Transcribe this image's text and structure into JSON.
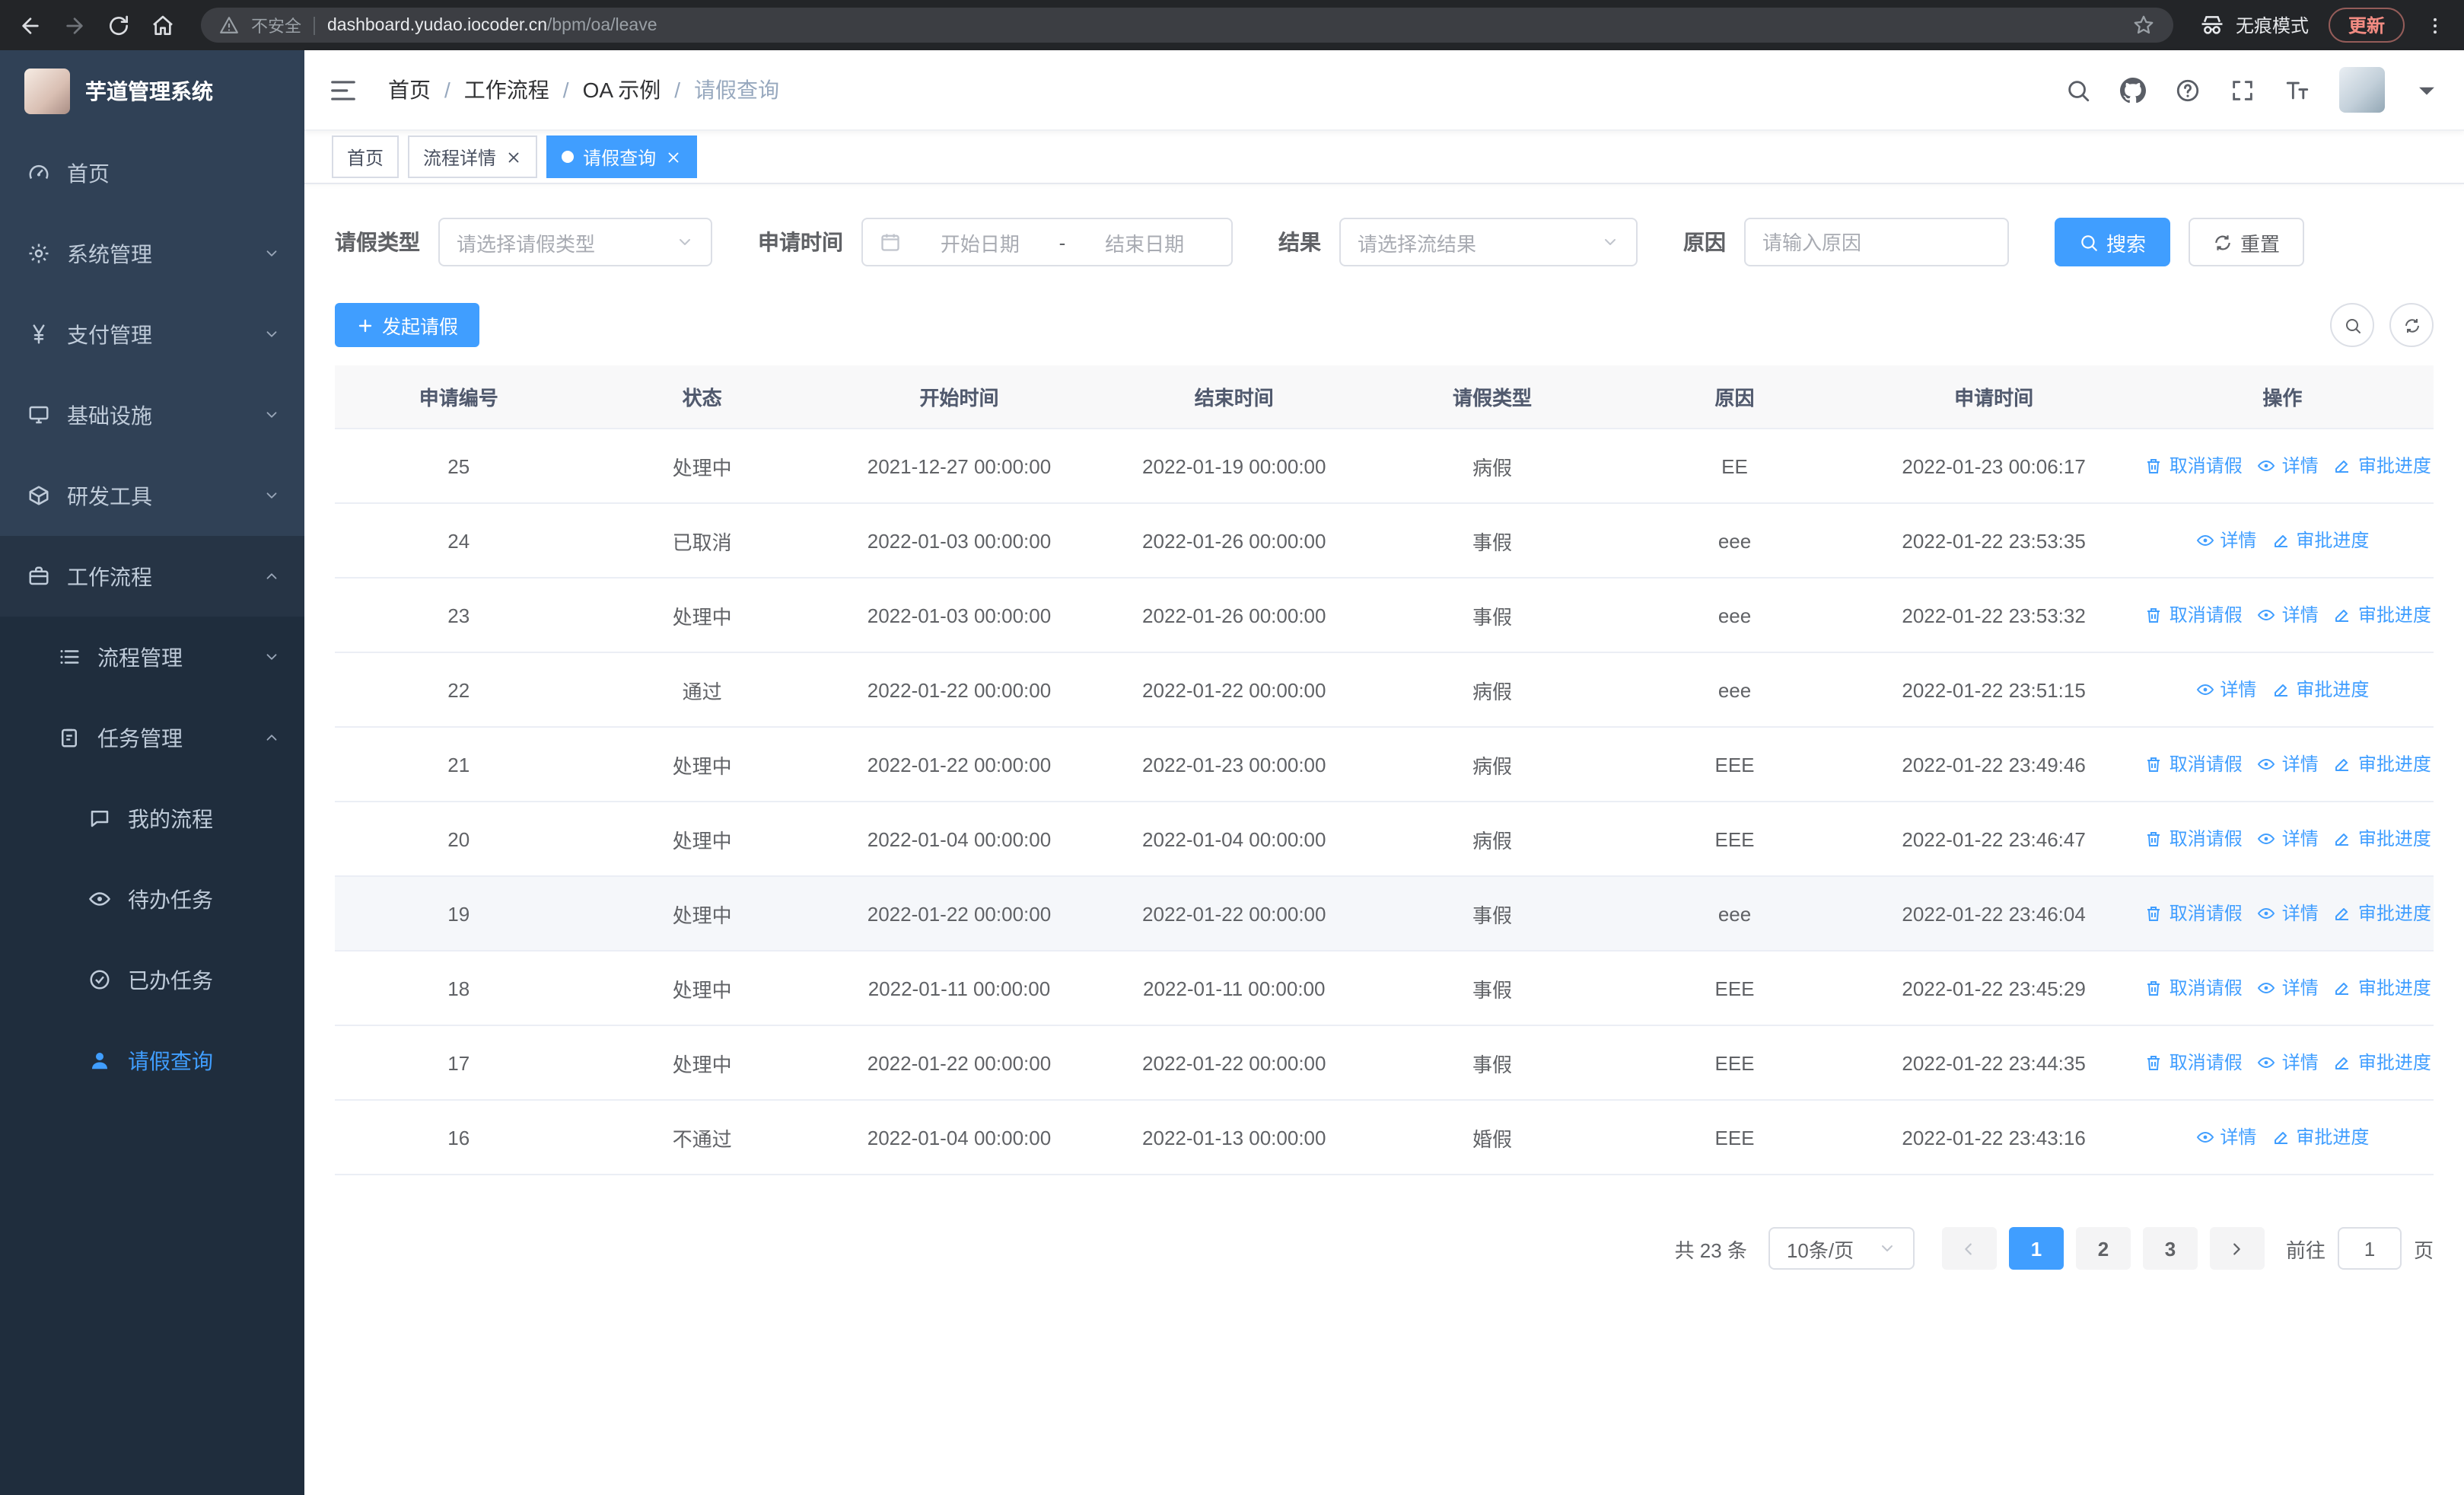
{
  "browser": {
    "security": "不安全",
    "url_domain": "dashboard.yudao.iocoder.cn",
    "url_path": "/bpm/oa/leave",
    "incognito": "无痕模式",
    "update": "更新"
  },
  "sidebar": {
    "title": "芋道管理系统",
    "menu": [
      {
        "key": "home",
        "label": "首页",
        "icon": "dashboard-icon",
        "level": 1,
        "arrow": null
      },
      {
        "key": "system",
        "label": "系统管理",
        "icon": "gear-icon",
        "level": 1,
        "arrow": "down"
      },
      {
        "key": "payment",
        "label": "支付管理",
        "icon": "yen-icon",
        "level": 1,
        "arrow": "down"
      },
      {
        "key": "infra",
        "label": "基础设施",
        "icon": "monitor-icon",
        "level": 1,
        "arrow": "down"
      },
      {
        "key": "dev-tools",
        "label": "研发工具",
        "icon": "box-icon",
        "level": 1,
        "arrow": "down"
      },
      {
        "key": "workflow",
        "label": "工作流程",
        "icon": "briefcase-icon",
        "level": 1,
        "arrow": "up",
        "open": true
      },
      {
        "key": "process-mgmt",
        "label": "流程管理",
        "icon": "list-icon",
        "level": 2,
        "arrow": "down"
      },
      {
        "key": "task-mgmt",
        "label": "任务管理",
        "icon": "clipboard-icon",
        "level": 2,
        "arrow": "up",
        "open": true
      },
      {
        "key": "my-process",
        "label": "我的流程",
        "icon": "chat-icon",
        "level": 3,
        "arrow": null
      },
      {
        "key": "todo-tasks",
        "label": "待办任务",
        "icon": "eye-icon",
        "level": 3,
        "arrow": null
      },
      {
        "key": "done-tasks",
        "label": "已办任务",
        "icon": "check-circle-icon",
        "level": 3,
        "arrow": null
      },
      {
        "key": "leave-query",
        "label": "请假查询",
        "icon": "user-icon",
        "level": 3,
        "arrow": null,
        "active": true
      }
    ]
  },
  "header": {
    "breadcrumb": [
      "首页",
      "工作流程",
      "OA 示例",
      "请假查询"
    ],
    "breadcrumb_separator": "/"
  },
  "tabs": [
    {
      "key": "home",
      "label": "首页",
      "active": false,
      "closable": false
    },
    {
      "key": "process-detail",
      "label": "流程详情",
      "active": false,
      "closable": true
    },
    {
      "key": "leave-query",
      "label": "请假查询",
      "active": true,
      "closable": true
    }
  ],
  "filters": {
    "leave_type_label": "请假类型",
    "leave_type_placeholder": "请选择请假类型",
    "apply_time_label": "申请时间",
    "start_date_placeholder": "开始日期",
    "range_separator": "-",
    "end_date_placeholder": "结束日期",
    "result_label": "结果",
    "result_placeholder": "请选择流结果",
    "reason_label": "原因",
    "reason_placeholder": "请输入原因",
    "search_button": "搜索",
    "reset_button": "重置"
  },
  "toolbar": {
    "create_button": "发起请假"
  },
  "table": {
    "columns": [
      "申请编号",
      "状态",
      "开始时间",
      "结束时间",
      "请假类型",
      "原因",
      "申请时间",
      "操作"
    ],
    "action_labels": {
      "cancel": "取消请假",
      "detail": "详情",
      "progress": "审批进度"
    },
    "rows": [
      {
        "id": "25",
        "status": "处理中",
        "start": "2021-12-27 00:00:00",
        "end": "2022-01-19 00:00:00",
        "type": "病假",
        "reason": "EE",
        "applied": "2022-01-23 00:06:17",
        "cancellable": true
      },
      {
        "id": "24",
        "status": "已取消",
        "start": "2022-01-03 00:00:00",
        "end": "2022-01-26 00:00:00",
        "type": "事假",
        "reason": "eee",
        "applied": "2022-01-22 23:53:35",
        "cancellable": false
      },
      {
        "id": "23",
        "status": "处理中",
        "start": "2022-01-03 00:00:00",
        "end": "2022-01-26 00:00:00",
        "type": "事假",
        "reason": "eee",
        "applied": "2022-01-22 23:53:32",
        "cancellable": true
      },
      {
        "id": "22",
        "status": "通过",
        "start": "2022-01-22 00:00:00",
        "end": "2022-01-22 00:00:00",
        "type": "病假",
        "reason": "eee",
        "applied": "2022-01-22 23:51:15",
        "cancellable": false
      },
      {
        "id": "21",
        "status": "处理中",
        "start": "2022-01-22 00:00:00",
        "end": "2022-01-23 00:00:00",
        "type": "病假",
        "reason": "EEE",
        "applied": "2022-01-22 23:49:46",
        "cancellable": true
      },
      {
        "id": "20",
        "status": "处理中",
        "start": "2022-01-04 00:00:00",
        "end": "2022-01-04 00:00:00",
        "type": "病假",
        "reason": "EEE",
        "applied": "2022-01-22 23:46:47",
        "cancellable": true
      },
      {
        "id": "19",
        "status": "处理中",
        "start": "2022-01-22 00:00:00",
        "end": "2022-01-22 00:00:00",
        "type": "事假",
        "reason": "eee",
        "applied": "2022-01-22 23:46:04",
        "cancellable": true,
        "hover": true
      },
      {
        "id": "18",
        "status": "处理中",
        "start": "2022-01-11 00:00:00",
        "end": "2022-01-11 00:00:00",
        "type": "事假",
        "reason": "EEE",
        "applied": "2022-01-22 23:45:29",
        "cancellable": true
      },
      {
        "id": "17",
        "status": "处理中",
        "start": "2022-01-22 00:00:00",
        "end": "2022-01-22 00:00:00",
        "type": "事假",
        "reason": "EEE",
        "applied": "2022-01-22 23:44:35",
        "cancellable": true
      },
      {
        "id": "16",
        "status": "不通过",
        "start": "2022-01-04 00:00:00",
        "end": "2022-01-13 00:00:00",
        "type": "婚假",
        "reason": "EEE",
        "applied": "2022-01-22 23:43:16",
        "cancellable": false
      }
    ]
  },
  "pagination": {
    "total_text": "共 23 条",
    "page_size": "10条/页",
    "pages": [
      "1",
      "2",
      "3"
    ],
    "active_page": "1",
    "goto_label": "前往",
    "goto_value": "1",
    "goto_suffix": "页"
  },
  "colors": {
    "primary": "#409eff",
    "sidebar_bg": "#304156",
    "sidebar_sub_bg": "#1f2d3d",
    "table_header_bg": "#f8f8f9",
    "update_badge": "#f28b82"
  }
}
